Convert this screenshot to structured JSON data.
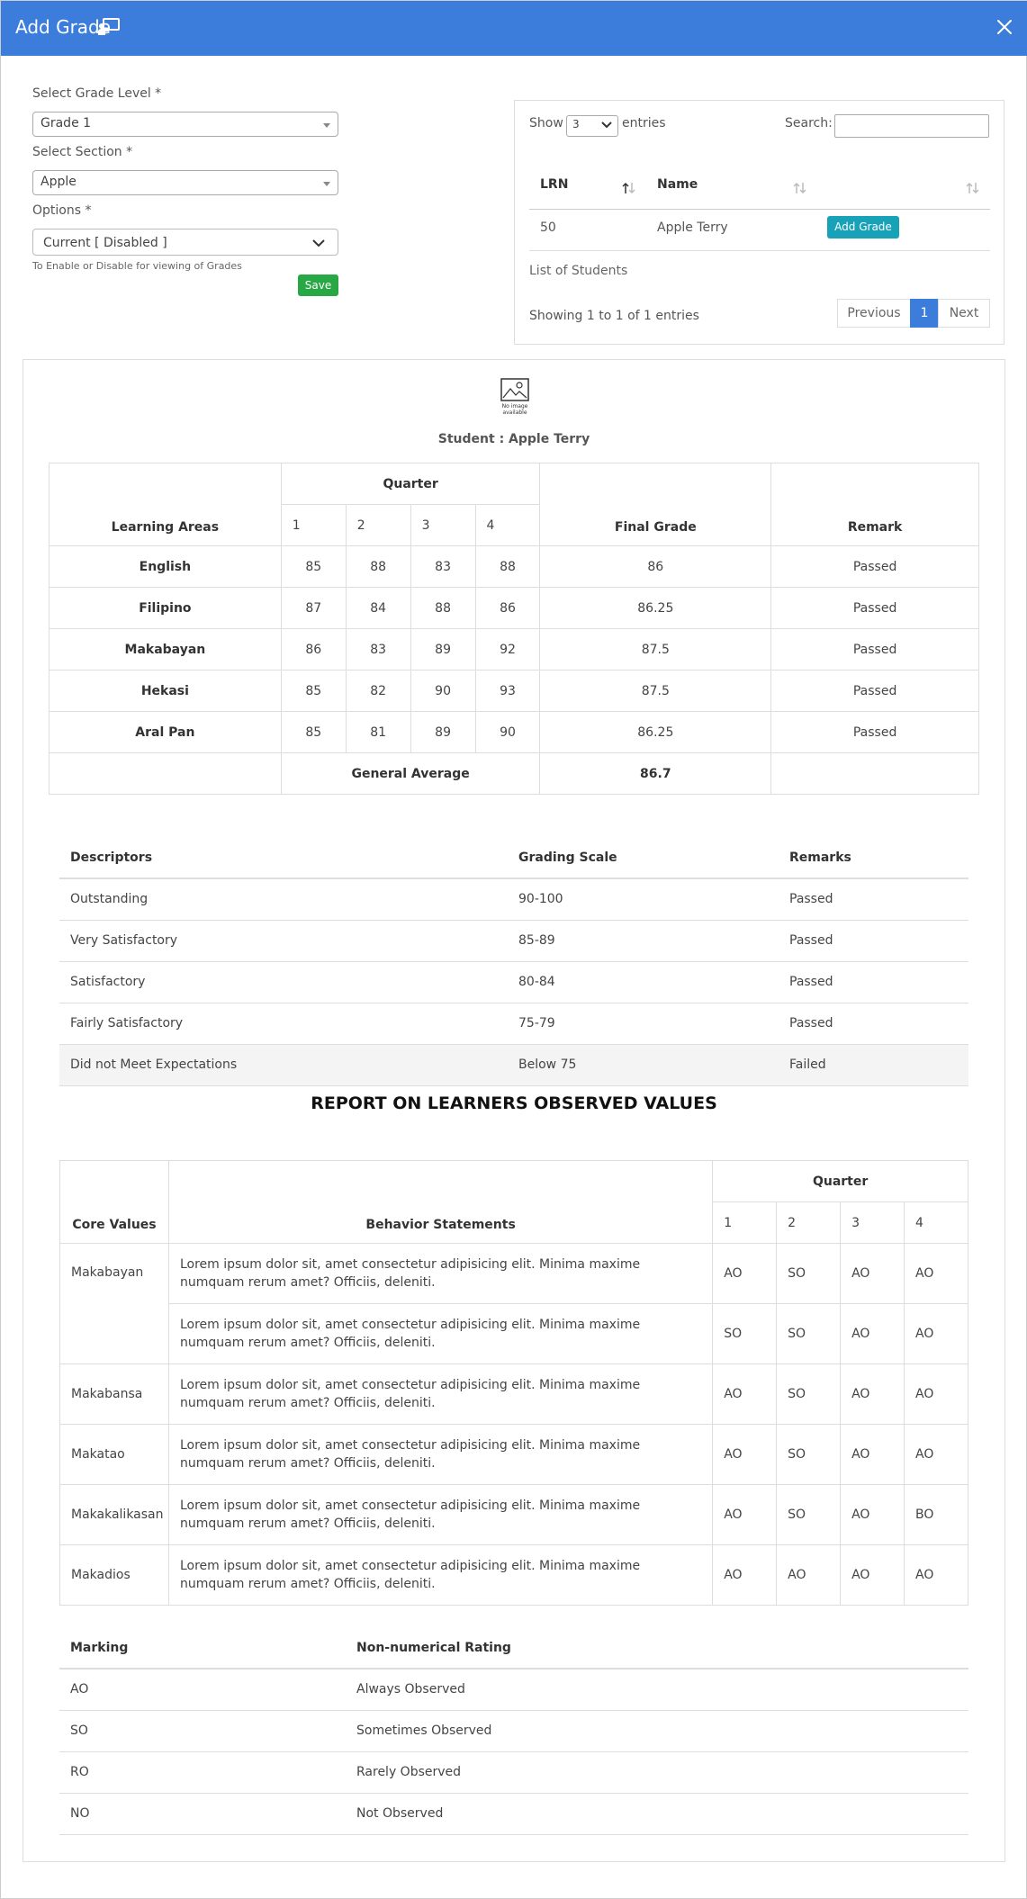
{
  "header": {
    "title": "Add Grade",
    "title_icon": "chalkboard-teacher-icon",
    "close_icon": "close-icon",
    "bg_color": "#3c7ddb"
  },
  "form": {
    "grade_level_label": "Select Grade Level *",
    "grade_level_value": "Grade 1",
    "section_label": "Select Section *",
    "section_value": "Apple",
    "options_label": "Options *",
    "options_value": "Current [ Disabled ]",
    "options_hint": "To Enable or Disable for viewing of Grades",
    "save_label": "Save"
  },
  "students_table": {
    "show_label": "Show",
    "entries_value": "3",
    "entries_label": "entries",
    "search_label": "Search:",
    "search_value": "",
    "columns": [
      "LRN",
      "Name"
    ],
    "rows": [
      {
        "lrn": "50",
        "name": "Apple Terry",
        "action": "Add Grade"
      }
    ],
    "caption": "List of Students",
    "info": "Showing 1 to 1 of 1 entries",
    "prev_label": "Previous",
    "page": "1",
    "next_label": "Next"
  },
  "report": {
    "student_label": "Student : Apple Terry",
    "image_alt": "No image available",
    "grades": {
      "headers": {
        "learning_areas": "Learning Areas",
        "quarter": "Quarter",
        "q1": "1",
        "q2": "2",
        "q3": "3",
        "q4": "4",
        "final": "Final Grade",
        "remark": "Remark"
      },
      "rows": [
        {
          "area": "English",
          "q1": "85",
          "q2": "88",
          "q3": "83",
          "q4": "88",
          "final": "86",
          "remark": "Passed"
        },
        {
          "area": "Filipino",
          "q1": "87",
          "q2": "84",
          "q3": "88",
          "q4": "86",
          "final": "86.25",
          "remark": "Passed"
        },
        {
          "area": "Makabayan",
          "q1": "86",
          "q2": "83",
          "q3": "89",
          "q4": "92",
          "final": "87.5",
          "remark": "Passed"
        },
        {
          "area": "Hekasi",
          "q1": "85",
          "q2": "82",
          "q3": "90",
          "q4": "93",
          "final": "87.5",
          "remark": "Passed"
        },
        {
          "area": "Aral Pan",
          "q1": "85",
          "q2": "81",
          "q3": "89",
          "q4": "90",
          "final": "86.25",
          "remark": "Passed"
        }
      ],
      "general_average_label": "General Average",
      "general_average": "86.7"
    },
    "descriptors": {
      "headers": [
        "Descriptors",
        "Grading Scale",
        "Remarks"
      ],
      "rows": [
        [
          "Outstanding",
          "90-100",
          "Passed"
        ],
        [
          "Very Satisfactory",
          "85-89",
          "Passed"
        ],
        [
          "Satisfactory",
          "80-84",
          "Passed"
        ],
        [
          "Fairly Satisfactory",
          "75-79",
          "Passed"
        ],
        [
          "Did not Meet Expectations",
          "Below 75",
          "Failed"
        ]
      ]
    },
    "values_title": "REPORT ON LEARNERS OBSERVED VALUES",
    "values": {
      "headers": {
        "core": "Core Values",
        "behavior": "Behavior Statements",
        "quarter": "Quarter",
        "q1": "1",
        "q2": "2",
        "q3": "3",
        "q4": "4"
      },
      "rows": [
        {
          "core": "Makabayan",
          "stmt": "Lorem ipsum dolor sit, amet consectetur adipisicing elit. Minima maxime numquam rerum amet? Officiis, deleniti.",
          "q": [
            "AO",
            "SO",
            "AO",
            "AO"
          ]
        },
        {
          "core": "",
          "stmt": "Lorem ipsum dolor sit, amet consectetur adipisicing elit. Minima maxime numquam rerum amet? Officiis, deleniti.",
          "q": [
            "SO",
            "SO",
            "AO",
            "AO"
          ]
        },
        {
          "core": "Makabansa",
          "stmt": "Lorem ipsum dolor sit, amet consectetur adipisicing elit. Minima maxime numquam rerum amet? Officiis, deleniti.",
          "q": [
            "AO",
            "SO",
            "AO",
            "AO"
          ]
        },
        {
          "core": "Makatao",
          "stmt": "Lorem ipsum dolor sit, amet consectetur adipisicing elit. Minima maxime numquam rerum amet? Officiis, deleniti.",
          "q": [
            "AO",
            "SO",
            "AO",
            "AO"
          ]
        },
        {
          "core": "Makakalikasan",
          "stmt": "Lorem ipsum dolor sit, amet consectetur adipisicing elit. Minima maxime numquam rerum amet? Officiis, deleniti.",
          "q": [
            "AO",
            "SO",
            "AO",
            "BO"
          ]
        },
        {
          "core": "Makadios",
          "stmt": "Lorem ipsum dolor sit, amet consectetur adipisicing elit. Minima maxime numquam rerum amet? Officiis, deleniti.",
          "q": [
            "AO",
            "AO",
            "AO",
            "AO"
          ]
        }
      ]
    },
    "markings": {
      "headers": [
        "Marking",
        "Non-numerical Rating"
      ],
      "rows": [
        [
          "AO",
          "Always Observed"
        ],
        [
          "SO",
          "Sometimes Observed"
        ],
        [
          "RO",
          "Rarely Observed"
        ],
        [
          "NO",
          "Not Observed"
        ]
      ]
    }
  }
}
